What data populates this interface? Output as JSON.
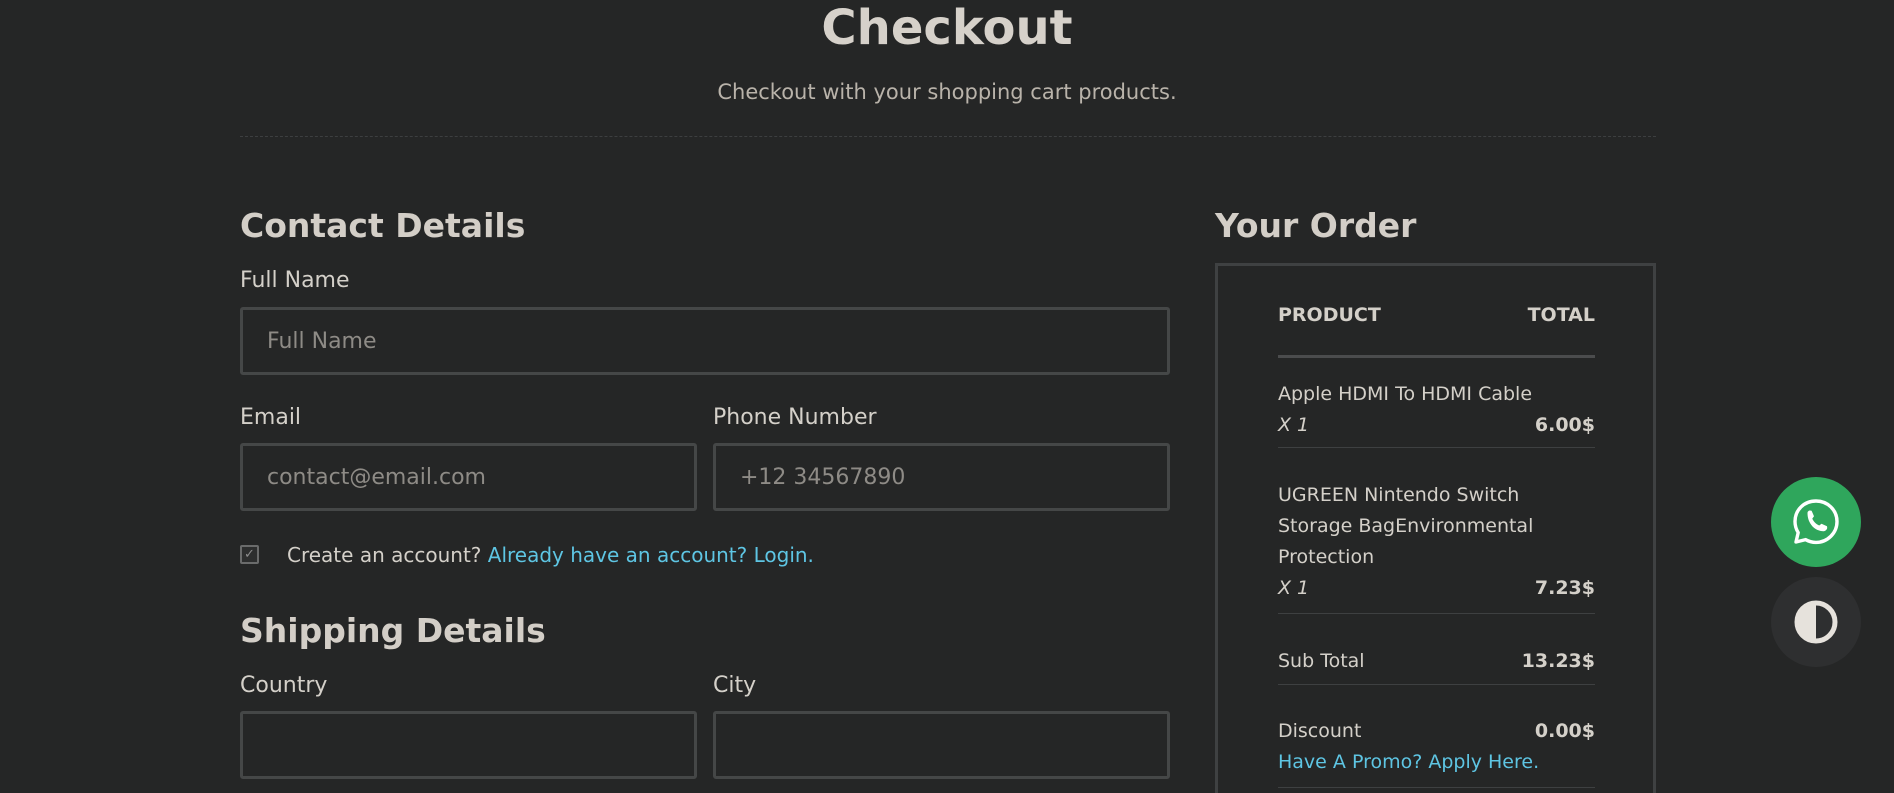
{
  "header": {
    "title": "Checkout",
    "subtitle": "Checkout with your shopping cart products."
  },
  "contact": {
    "title": "Contact Details",
    "full_name_label": "Full Name",
    "full_name_placeholder": "Full Name",
    "email_label": "Email",
    "email_placeholder": "contact@email.com",
    "phone_label": "Phone Number",
    "phone_placeholder": "+12 34567890",
    "create_account_text": "Create an account?",
    "login_link": "Already have an account? Login."
  },
  "shipping": {
    "title": "Shipping Details",
    "country_label": "Country",
    "city_label": "City"
  },
  "order": {
    "title": "Your Order",
    "col_product": "PRODUCT",
    "col_total": "TOTAL",
    "items": [
      {
        "name": "Apple HDMI To HDMI Cable",
        "qty": "X 1",
        "price": "6.00$"
      },
      {
        "name": "UGREEN Nintendo Switch Storage BagEnvironmental Protection",
        "qty": "X 1",
        "price": "7.23$"
      }
    ],
    "subtotal_label": "Sub Total",
    "subtotal_value": "13.23$",
    "discount_label": "Discount",
    "discount_value": "0.00$",
    "promo_link": "Have A Promo? Apply Here."
  },
  "fabs": {
    "whatsapp_icon": "whatsapp-icon",
    "theme_icon": "contrast-icon",
    "whatsapp_color": "#2fa65c"
  }
}
